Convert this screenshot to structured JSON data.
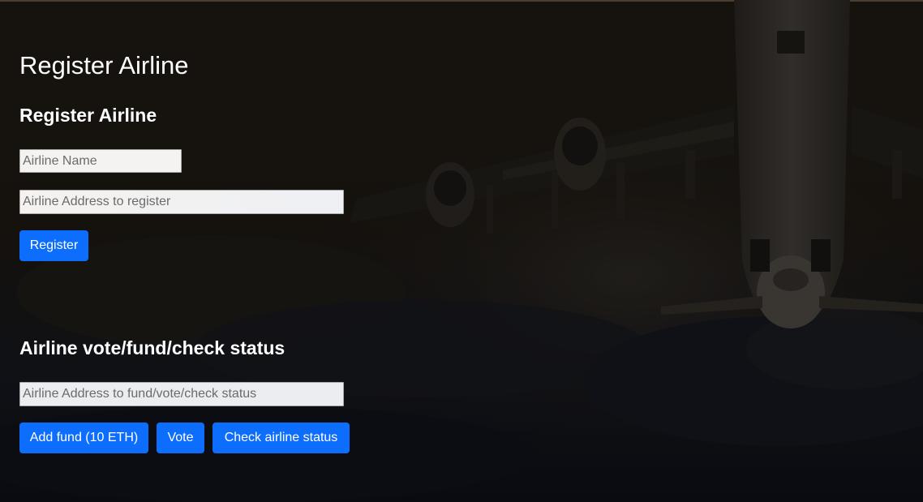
{
  "page": {
    "title": "Register Airline"
  },
  "register_section": {
    "heading": "Register Airline",
    "airline_name_placeholder": "Airline Name",
    "airline_address_placeholder": "Airline Address to register",
    "register_label": "Register"
  },
  "status_section": {
    "heading": "Airline vote/fund/check status",
    "address_placeholder": "Airline Address to fund/vote/check status",
    "add_fund_label": "Add fund (10 ETH)",
    "vote_label": "Vote",
    "check_status_label": "Check airline status"
  },
  "colors": {
    "primary_button": "#0d6efd",
    "background": "#16130f",
    "text": "#ffffff"
  },
  "background_image": "airplane-takeoff-sunset"
}
